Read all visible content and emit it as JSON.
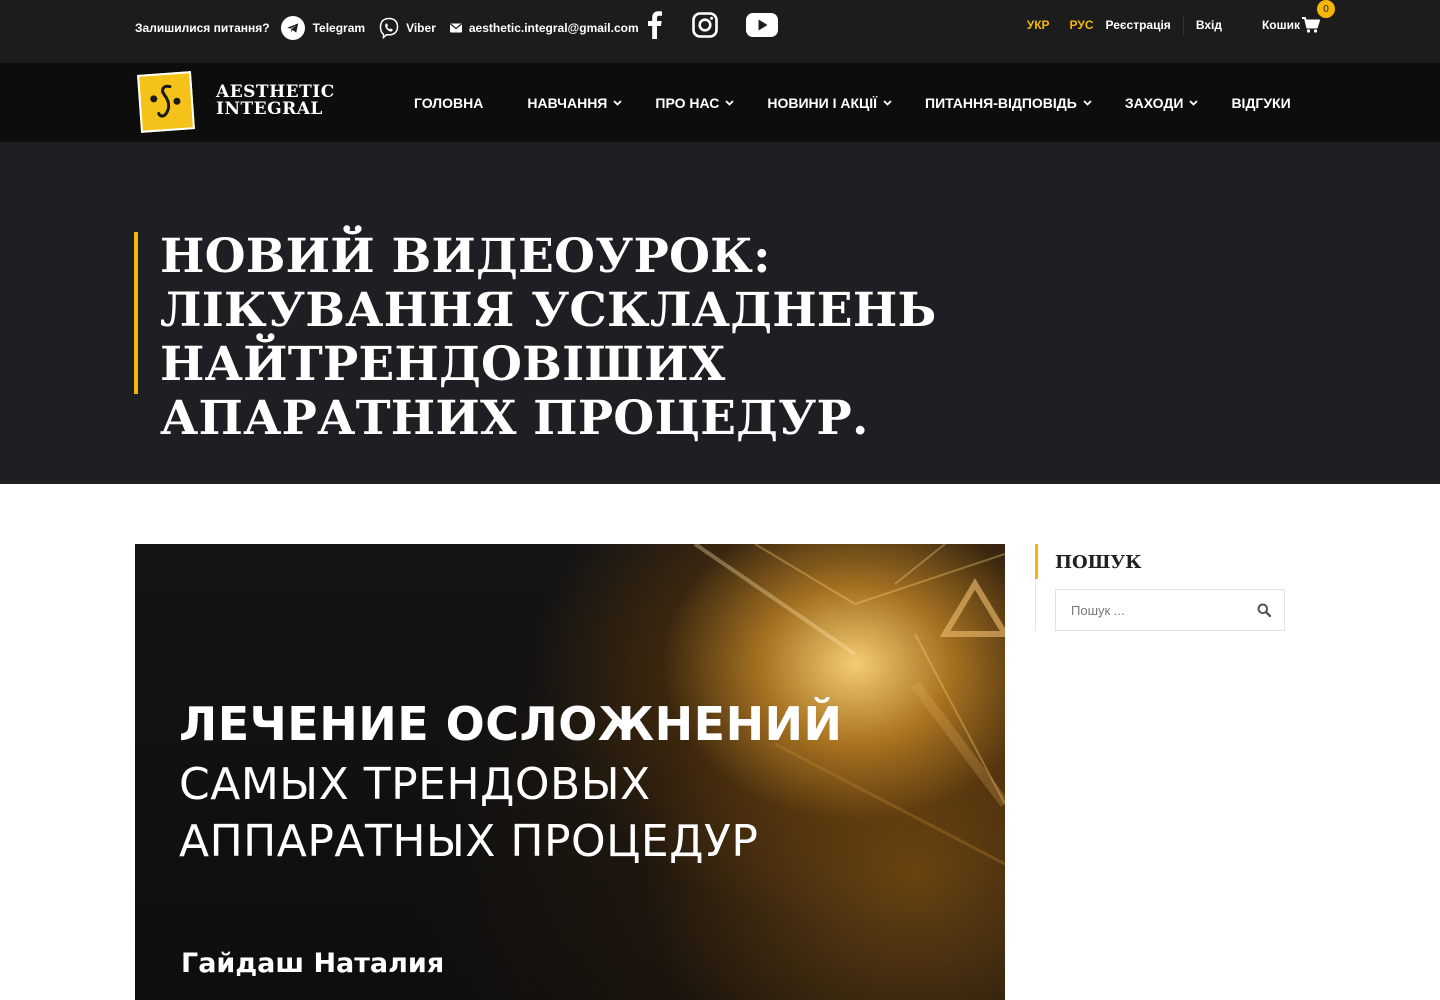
{
  "topbar": {
    "question": "Залишилися питання?",
    "telegram": "Telegram",
    "viber": "Viber",
    "email": "aesthetic.integral@gmail.com",
    "social_icons": [
      "facebook-icon",
      "instagram-icon",
      "youtube-icon"
    ],
    "lang_ukr": "УКР",
    "lang_rus": "РУС",
    "register": "Реєстрація",
    "login": "Вхід",
    "cart": "Кошик",
    "cart_count": "0"
  },
  "logo": {
    "line1": "AESTHETIC",
    "line2": "INTEGRAL"
  },
  "nav": {
    "items": [
      {
        "label": "ГОЛОВНА",
        "dropdown": false
      },
      {
        "label": "НАВЧАННЯ",
        "dropdown": true
      },
      {
        "label": "ПРО НАС",
        "dropdown": true
      },
      {
        "label": "НОВИНИ І АКЦІЇ",
        "dropdown": true
      },
      {
        "label": "ПИТАННЯ-ВІДПОВІДЬ",
        "dropdown": true
      },
      {
        "label": "ЗАХОДИ",
        "dropdown": true
      },
      {
        "label": "ВІДГУКИ",
        "dropdown": false
      }
    ]
  },
  "hero": {
    "title": "НОВИЙ ВИДЕОУРОК: ЛІКУВАННЯ УСКЛАДНЕНЬ НАЙТРЕНДОВІШИХ АПАРАТНИХ ПРОЦЕДУР."
  },
  "featured_image": {
    "line1": "ЛЕЧЕНИЕ ОСЛОЖНЕНИЙ",
    "line2": "САМЫХ ТРЕНДОВЫХ",
    "line3": "АППАРАТНЫХ ПРОЦЕДУР",
    "author": "Гайдаш Наталия"
  },
  "sidebar": {
    "search_title": "ПОШУК",
    "search_placeholder": "Пошук ..."
  },
  "colors": {
    "accent": "#f5b60a",
    "topbar_bg": "#1c1c1c",
    "navbar_bg": "#0d0d0d",
    "hero_bg": "#1e1f22"
  }
}
